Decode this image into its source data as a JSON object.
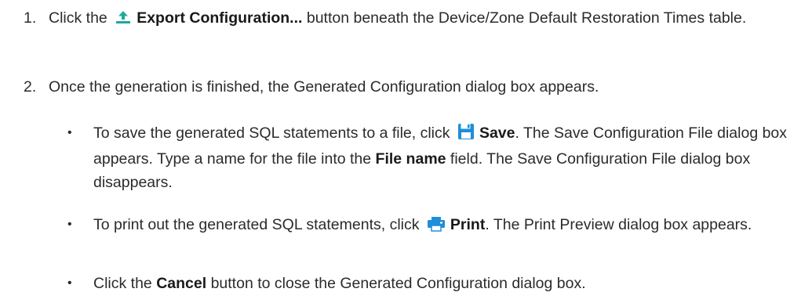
{
  "steps": [
    {
      "number": "1.",
      "pre": "Click the",
      "icon": "export-upload-icon",
      "button_label": "Export Configuration...",
      "post": "button beneath the Device/Zone Default Restoration Times table."
    },
    {
      "number": "2.",
      "text": "Once the generation is finished, the Generated Configuration dialog box appears."
    }
  ],
  "bullets": [
    {
      "marker": "•",
      "pre": "To save the generated SQL statements to a file, click",
      "icon": "save-floppy-icon",
      "button_label": "Save",
      "mid": ". The Save Configuration File dialog box appears. Type a name for the file into the",
      "field_label": "File name",
      "post": "field. The Save Configuration File dialog box disappears."
    },
    {
      "marker": "•",
      "pre": "To print out the generated SQL statements, click",
      "icon": "print-icon",
      "button_label": "Print",
      "post": ". The Print Preview dialog box appears."
    },
    {
      "marker": "•",
      "pre": "Click the",
      "button_label": "Cancel",
      "post": "button to close the Generated Configuration dialog box."
    }
  ],
  "colors": {
    "export_icon": "#1ea9a0",
    "save_icon": "#1f8ed8",
    "print_icon": "#1f8ed8"
  }
}
